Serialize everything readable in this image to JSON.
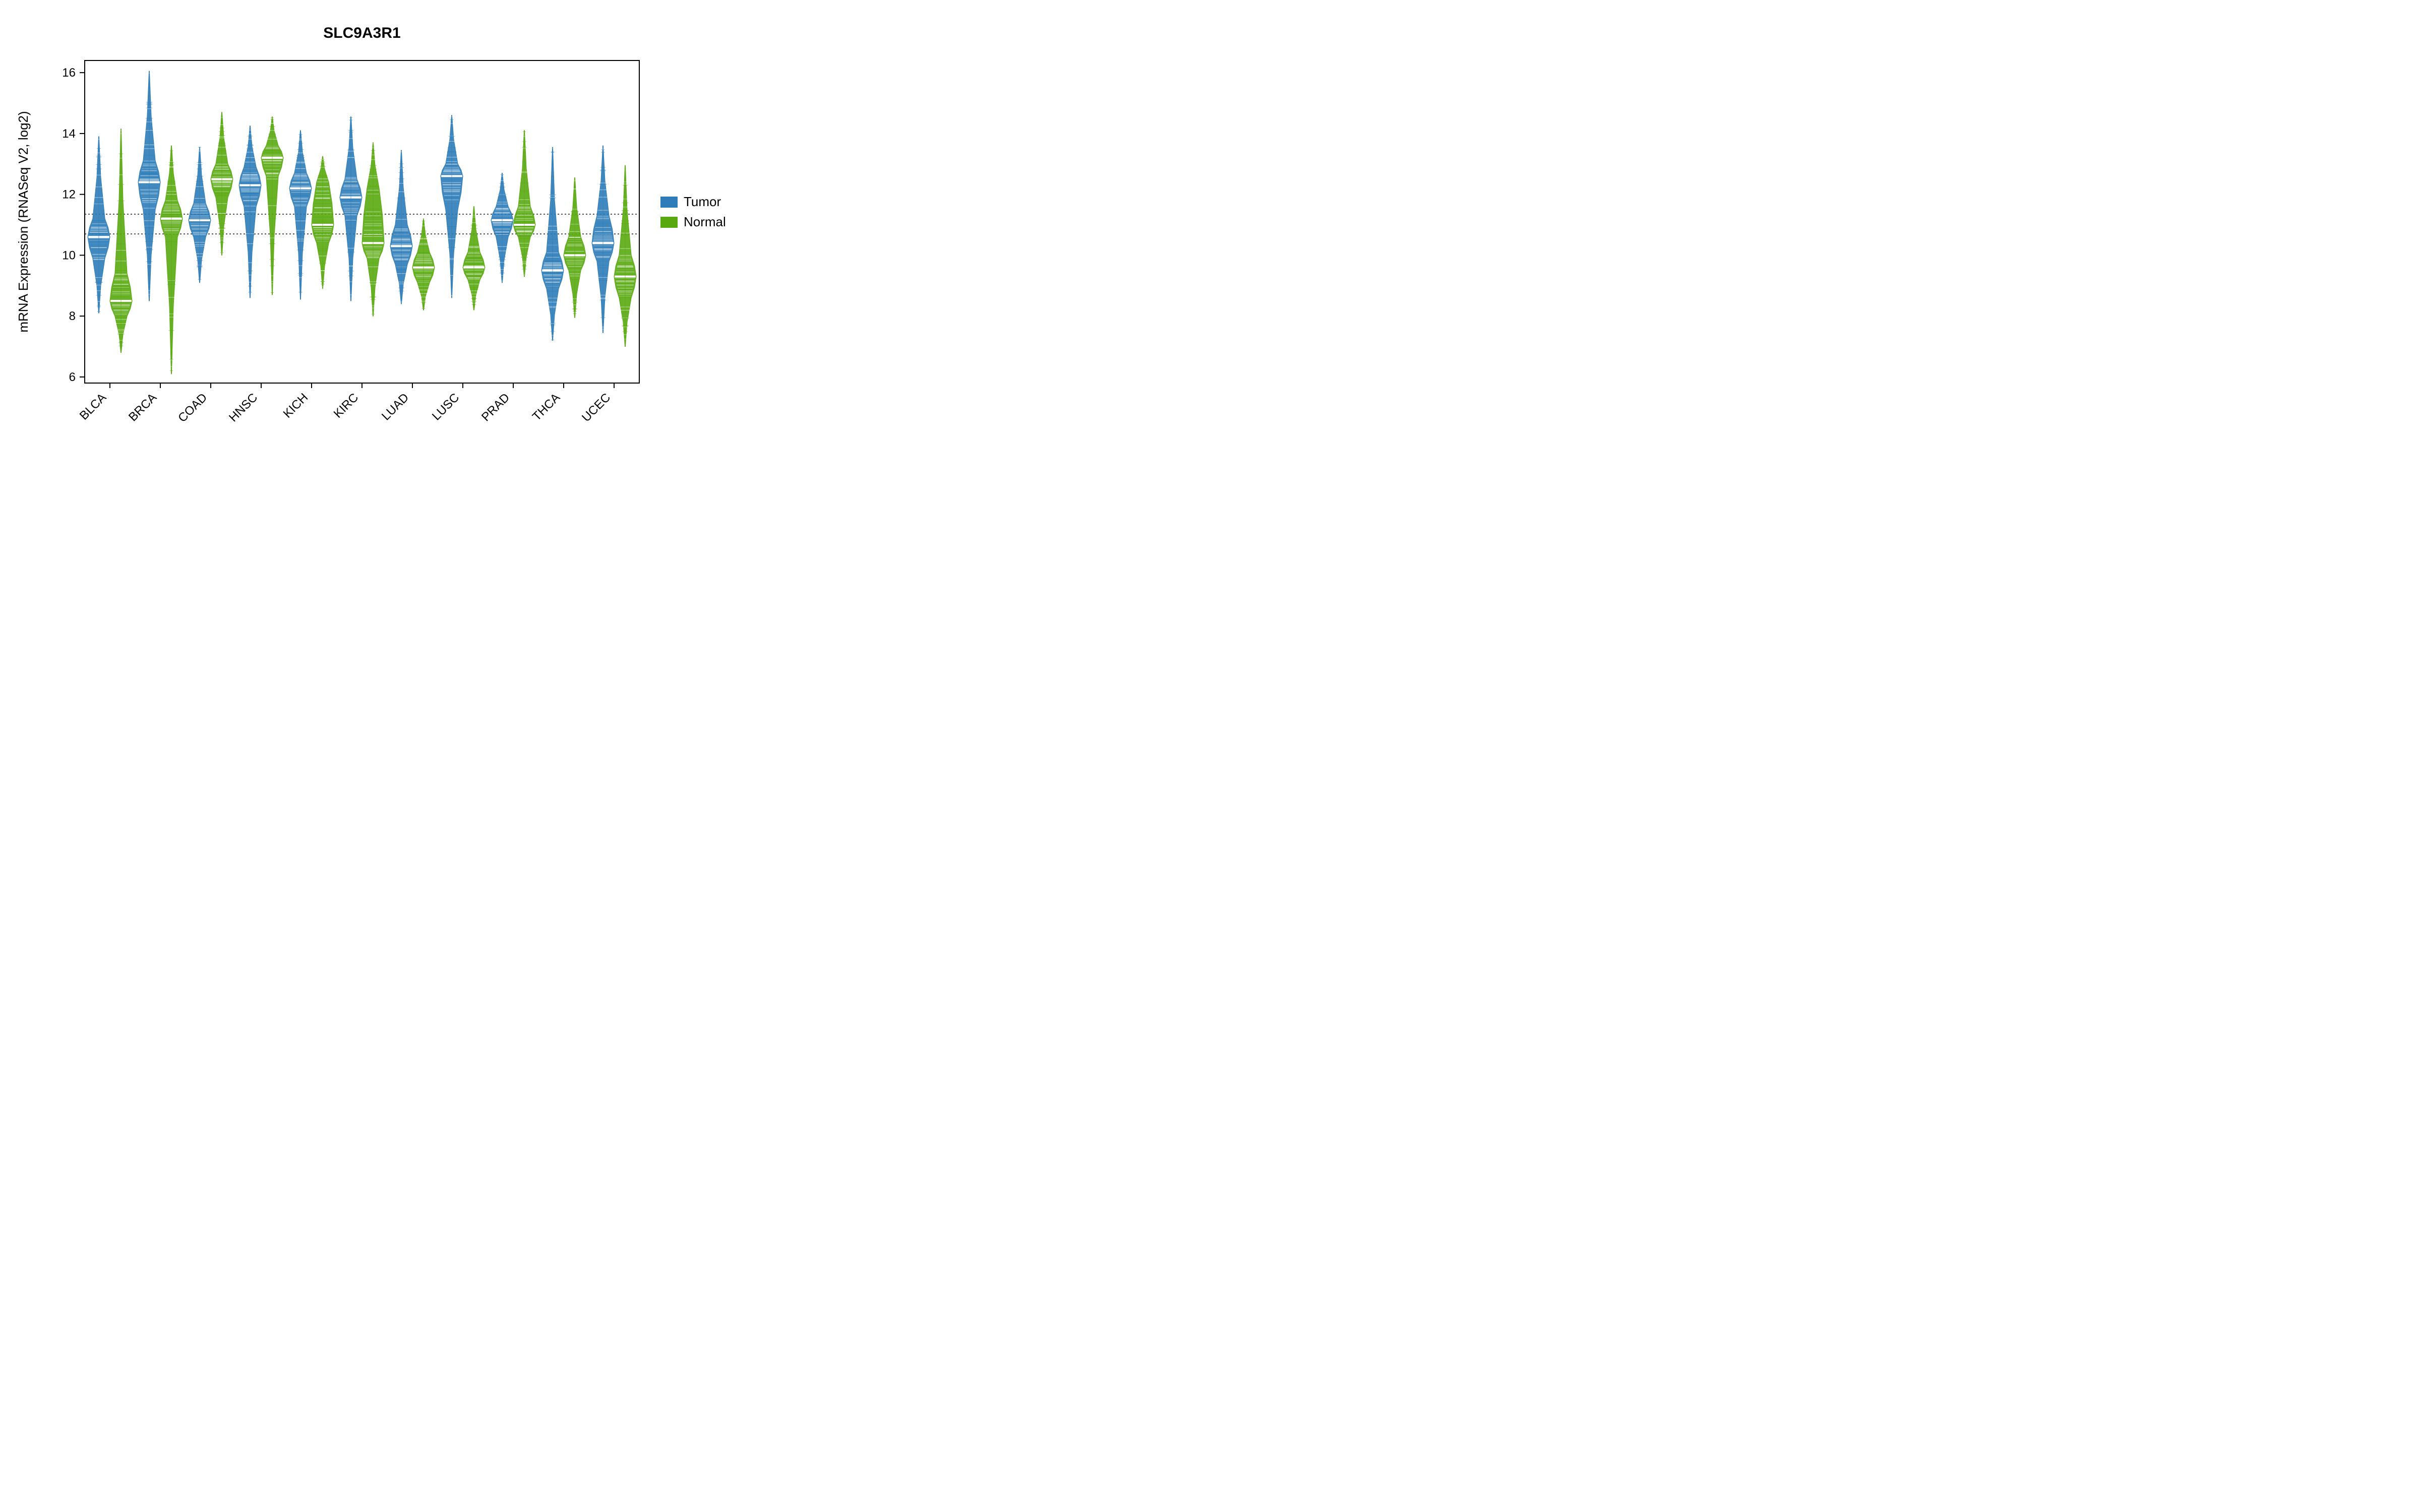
{
  "chart_data": {
    "type": "violin",
    "title": "SLC9A3R1",
    "ylabel": "mRNA Expression (RNASeq V2, log2)",
    "xlabel": "",
    "ylim": [
      5.8,
      16.4
    ],
    "yticks": [
      6,
      8,
      10,
      12,
      14,
      16
    ],
    "categories": [
      "BLCA",
      "BRCA",
      "COAD",
      "HNSC",
      "KICH",
      "KIRC",
      "LUAD",
      "LUSC",
      "PRAD",
      "THCA",
      "UCEC"
    ],
    "reference_lines": [
      10.7,
      11.35
    ],
    "legend": {
      "items": [
        "Tumor",
        "Normal"
      ],
      "colors": [
        "#2e7cb8",
        "#59a80f"
      ]
    },
    "series": [
      {
        "name": "Tumor",
        "color": "#2e7cb8",
        "distributions": [
          {
            "cat": "BLCA",
            "min": 8.1,
            "q1": 9.9,
            "median": 10.6,
            "q3": 11.2,
            "max": 13.9,
            "outliers": []
          },
          {
            "cat": "BRCA",
            "min": 8.5,
            "q1": 11.5,
            "median": 12.4,
            "q3": 13.1,
            "max": 16.05,
            "outliers": []
          },
          {
            "cat": "COAD",
            "min": 9.1,
            "q1": 10.6,
            "median": 11.15,
            "q3": 11.7,
            "max": 13.55,
            "outliers": []
          },
          {
            "cat": "HNSC",
            "min": 8.6,
            "q1": 11.6,
            "median": 12.3,
            "q3": 12.9,
            "max": 14.25,
            "outliers": []
          },
          {
            "cat": "KICH",
            "min": 8.55,
            "q1": 11.6,
            "median": 12.2,
            "q3": 12.7,
            "max": 14.1,
            "outliers": []
          },
          {
            "cat": "KIRC",
            "min": 8.5,
            "q1": 11.3,
            "median": 11.9,
            "q3": 12.5,
            "max": 14.55,
            "outliers": []
          },
          {
            "cat": "LUAD",
            "min": 8.4,
            "q1": 9.7,
            "median": 10.3,
            "q3": 11.0,
            "max": 13.45,
            "outliers": []
          },
          {
            "cat": "LUSC",
            "min": 8.6,
            "q1": 11.5,
            "median": 12.6,
            "q3": 13.0,
            "max": 14.6,
            "outliers": []
          },
          {
            "cat": "PRAD",
            "min": 9.1,
            "q1": 10.6,
            "median": 11.15,
            "q3": 11.6,
            "max": 12.7,
            "outliers": []
          },
          {
            "cat": "THCA",
            "min": 7.2,
            "q1": 8.9,
            "median": 9.5,
            "q3": 10.1,
            "max": 13.55,
            "outliers": []
          },
          {
            "cat": "UCEC",
            "min": 7.45,
            "q1": 9.8,
            "median": 10.4,
            "q3": 11.3,
            "max": 13.6,
            "outliers": []
          }
        ]
      },
      {
        "name": "Normal",
        "color": "#59a80f",
        "distributions": [
          {
            "cat": "BLCA",
            "min": 6.8,
            "q1": 8.0,
            "median": 8.5,
            "q3": 9.4,
            "max": 14.15,
            "outliers": []
          },
          {
            "cat": "BRCA",
            "min": 6.1,
            "q1": 10.6,
            "median": 11.2,
            "q3": 11.8,
            "max": 13.6,
            "outliers": [
              6.1
            ]
          },
          {
            "cat": "COAD",
            "min": 10.0,
            "q1": 11.9,
            "median": 12.5,
            "q3": 13.0,
            "max": 14.7,
            "outliers": []
          },
          {
            "cat": "HNSC",
            "min": 8.7,
            "q1": 12.6,
            "median": 13.2,
            "q3": 13.6,
            "max": 14.55,
            "outliers": [
              8.7
            ]
          },
          {
            "cat": "KICH",
            "min": 8.9,
            "q1": 10.4,
            "median": 11.0,
            "q3": 12.4,
            "max": 13.25,
            "outliers": []
          },
          {
            "cat": "KIRC",
            "min": 8.0,
            "q1": 9.9,
            "median": 10.4,
            "q3": 12.2,
            "max": 13.7,
            "outliers": []
          },
          {
            "cat": "LUAD",
            "min": 8.2,
            "q1": 9.1,
            "median": 9.6,
            "q3": 10.1,
            "max": 11.2,
            "outliers": []
          },
          {
            "cat": "LUSC",
            "min": 8.2,
            "q1": 9.2,
            "median": 9.6,
            "q3": 10.1,
            "max": 11.6,
            "outliers": []
          },
          {
            "cat": "PRAD",
            "min": 9.3,
            "q1": 10.6,
            "median": 11.0,
            "q3": 11.6,
            "max": 14.1,
            "outliers": []
          },
          {
            "cat": "THCA",
            "min": 7.95,
            "q1": 9.5,
            "median": 10.0,
            "q3": 10.6,
            "max": 12.55,
            "outliers": [
              7.95,
              12.55
            ]
          },
          {
            "cat": "UCEC",
            "min": 7.0,
            "q1": 8.6,
            "median": 9.3,
            "q3": 10.0,
            "max": 12.95,
            "outliers": []
          }
        ]
      }
    ]
  }
}
